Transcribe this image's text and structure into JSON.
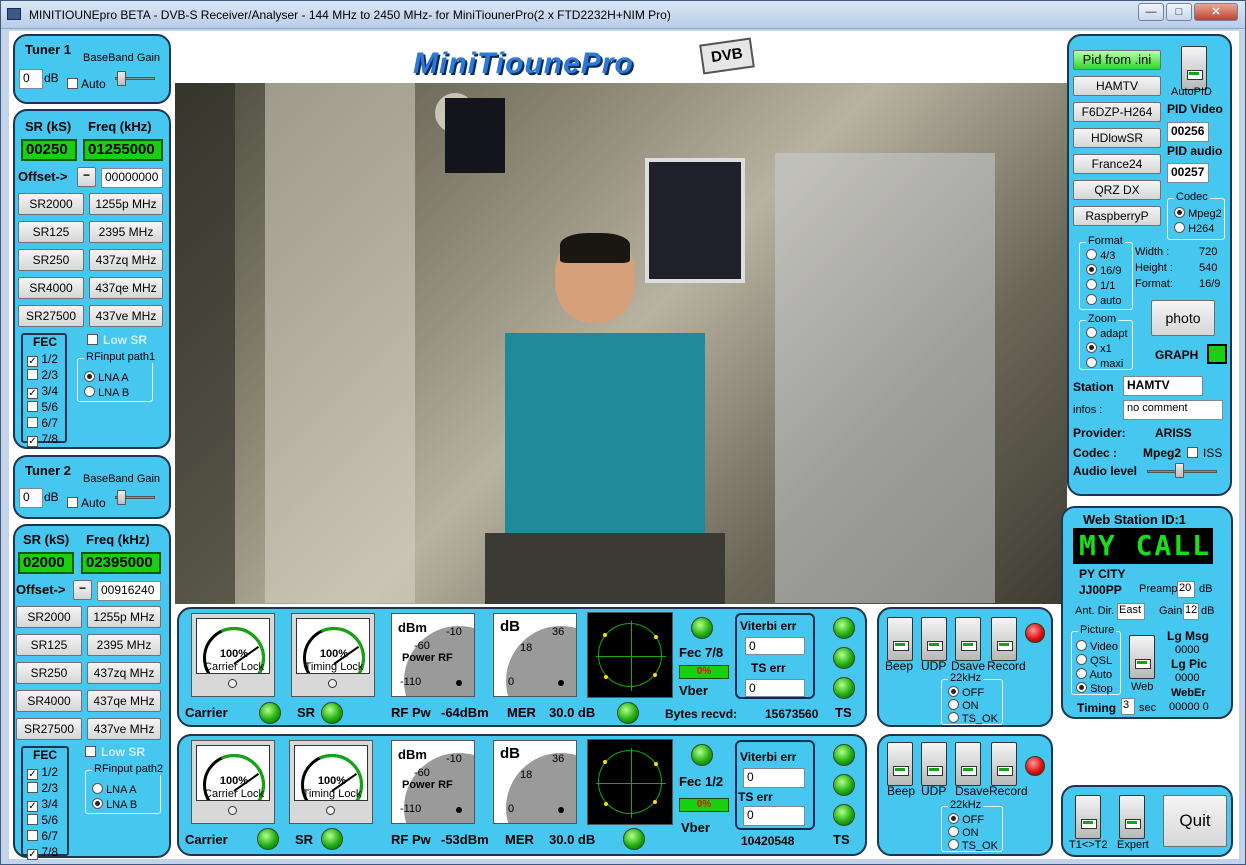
{
  "window": {
    "title": "MINITIOUNEpro BETA - DVB-S Receiver/Analyser - 144 MHz to 2450 MHz- for MiniTiounerPro(2 x FTD2232H+NIM Pro)",
    "min": "—",
    "max": "□",
    "close": "✕"
  },
  "logo": {
    "text": "MiniTiounePro",
    "badge": "DVB"
  },
  "tuner1": {
    "title": "Tuner 1",
    "bb_label": "BaseBand Gain",
    "gain": "0",
    "unit": "dB",
    "auto": "Auto"
  },
  "tuner2": {
    "title": "Tuner 2",
    "bb_label": "BaseBand Gain",
    "gain": "0",
    "unit": "dB",
    "auto": "Auto"
  },
  "rx1": {
    "sr_label": "SR (kS)",
    "freq_label": "Freq (kHz)",
    "sr": "00250",
    "freq": "01255000",
    "offset_label": "Offset->",
    "minus": "−",
    "offset": "00000000",
    "sr_buttons": [
      "SR2000",
      "SR125",
      "SR250",
      "SR4000",
      "SR27500"
    ],
    "freq_buttons": [
      "1255p MHz",
      "2395 MHz",
      "437zq MHz",
      "437qe MHz",
      "437ve MHz"
    ],
    "fec_title": "FEC",
    "fec": [
      {
        "l": "1/2",
        "c": "✓"
      },
      {
        "l": "2/3",
        "c": ""
      },
      {
        "l": "3/4",
        "c": "✓"
      },
      {
        "l": "5/6",
        "c": ""
      },
      {
        "l": "6/7",
        "c": ""
      },
      {
        "l": "7/8",
        "c": "✓"
      }
    ],
    "low_sr": "Low SR",
    "rf_title": "RFinput path1",
    "lna_a": "LNA A",
    "lna_b": "LNA B"
  },
  "rx2": {
    "sr_label": "SR (kS)",
    "freq_label": "Freq (kHz)",
    "sr": "02000",
    "freq": "02395000",
    "offset_label": "Offset->",
    "minus": "−",
    "offset": "00916240",
    "sr_buttons": [
      "SR2000",
      "SR125",
      "SR250",
      "SR4000",
      "SR27500"
    ],
    "freq_buttons": [
      "1255p MHz",
      "2395 MHz",
      "437zq MHz",
      "437qe MHz",
      "437ve MHz"
    ],
    "fec_title": "FEC",
    "fec": [
      {
        "l": "1/2",
        "c": "✓"
      },
      {
        "l": "2/3",
        "c": ""
      },
      {
        "l": "3/4",
        "c": "✓"
      },
      {
        "l": "5/6",
        "c": ""
      },
      {
        "l": "6/7",
        "c": ""
      },
      {
        "l": "7/8",
        "c": "✓"
      }
    ],
    "low_sr": "Low SR",
    "rf_title": "RFinput path2",
    "lna_a": "LNA A",
    "lna_b": "LNA B"
  },
  "status1": {
    "carrier_pct": "100%",
    "carrier_lab": "Carrier Lock",
    "timing_pct": "100%",
    "timing_lab": "Timing Lock",
    "dbm": "dBm",
    "m10": "-10",
    "m60": "-60",
    "power_rf": "Power RF",
    "m110": "-110",
    "db": "dB",
    "d36": "36",
    "d18": "18",
    "d0": "0",
    "fec": "Fec 7/8",
    "fec_bar": "0%",
    "vber": "Vber",
    "viterbi_label": "Viterbi err",
    "viterbi": "0",
    "ts_label": "TS err",
    "ts": "0",
    "carrier": "Carrier",
    "sr": "SR",
    "rfpw_label": "RF Pw",
    "rfpw": "-64dBm",
    "mer_label": "MER",
    "mer": "30.0 dB",
    "bytes_label": "Bytes recvd:",
    "bytes": "15673560",
    "ts_led": "TS"
  },
  "status2": {
    "carrier_pct": "100%",
    "carrier_lab": "Carrier Lock",
    "timing_pct": "100%",
    "timing_lab": "Timing Lock",
    "dbm": "dBm",
    "m10": "-10",
    "m60": "-60",
    "power_rf": "Power RF",
    "m110": "-110",
    "db": "dB",
    "d36": "36",
    "d18": "18",
    "d0": "0",
    "fec": "Fec 1/2",
    "fec_bar": "0%",
    "vber": "Vber",
    "viterbi_label": "Viterbi err",
    "viterbi": "0",
    "ts_label": "TS err",
    "ts": "0",
    "carrier": "Carrier",
    "sr": "SR",
    "rfpw_label": "RF Pw",
    "rfpw": "-53dBm",
    "mer_label": "MER",
    "mer": "30.0 dB",
    "bytes": "10420548",
    "ts_led": "TS"
  },
  "sw1": {
    "beep": "Beep",
    "udp": "UDP",
    "dsave": "Dsave",
    "record": "Record",
    "khz_title": "22kHz",
    "off": "OFF",
    "on": "ON",
    "ts_ok": "TS_OK"
  },
  "sw2": {
    "beep": "Beep",
    "udp": "UDP",
    "dsave": "Dsave",
    "record": "Record",
    "khz_title": "22kHz",
    "off": "OFF",
    "on": "ON",
    "ts_ok": "TS_OK"
  },
  "right": {
    "pid_ini": "Pid from .ini",
    "presets": [
      "HAMTV",
      "F6DZP-H264",
      "HDlowSR",
      "France24",
      "QRZ DX",
      "RaspberryP"
    ],
    "autopid": "AutoPID",
    "pid_video_label": "PID Video",
    "pid_video": "00256",
    "pid_audio_label": "PID audio",
    "pid_audio": "00257",
    "codec_title": "Codec",
    "mpeg2": "Mpeg2",
    "h264": "H264",
    "format_title": "Format",
    "f43": "4/3",
    "f169": "16/9",
    "f11": "1/1",
    "fauto": "auto",
    "width_label": "Width :",
    "width": "720",
    "height_label": "Height :",
    "height": "540",
    "format_label": "Format:",
    "format": "16/9",
    "zoom_title": "Zoom",
    "adapt": "adapt",
    "x1": "x1",
    "maxi": "maxi",
    "photo": "photo",
    "graph": "GRAPH",
    "station_label": "Station",
    "station": "HAMTV",
    "infos_label": "infos :",
    "infos": "no comment",
    "provider_label": "Provider:",
    "provider": "ARISS",
    "codec_label": "Codec :",
    "codec": "Mpeg2",
    "iss": "ISS",
    "audio_label": "Audio level"
  },
  "web": {
    "title": "Web Station ID:1",
    "display": "MY CALL",
    "city": "PY CITY",
    "locator": "JJ00PP",
    "preamp_label": "Preamp",
    "preamp": "20",
    "db": "dB",
    "antdir_label": "Ant. Dir.",
    "antdir": "East",
    "gain_label": "Gain",
    "gain": "12",
    "picture_title": "Picture",
    "video": "Video",
    "qsl": "QSL",
    "auto": "Auto",
    "stop": "Stop",
    "web_label": "Web",
    "lgmsg_label": "Lg Msg",
    "lgmsg": "0000",
    "lgpic_label": "Lg Pic",
    "lgpic": "0000",
    "weber_label": "WebEr",
    "weber": "00000 0",
    "timing_label": "Timing",
    "timing": "3",
    "sec": "sec"
  },
  "bottom": {
    "t1t2": "T1<>T2",
    "expert": "Expert",
    "quit": "Quit"
  }
}
